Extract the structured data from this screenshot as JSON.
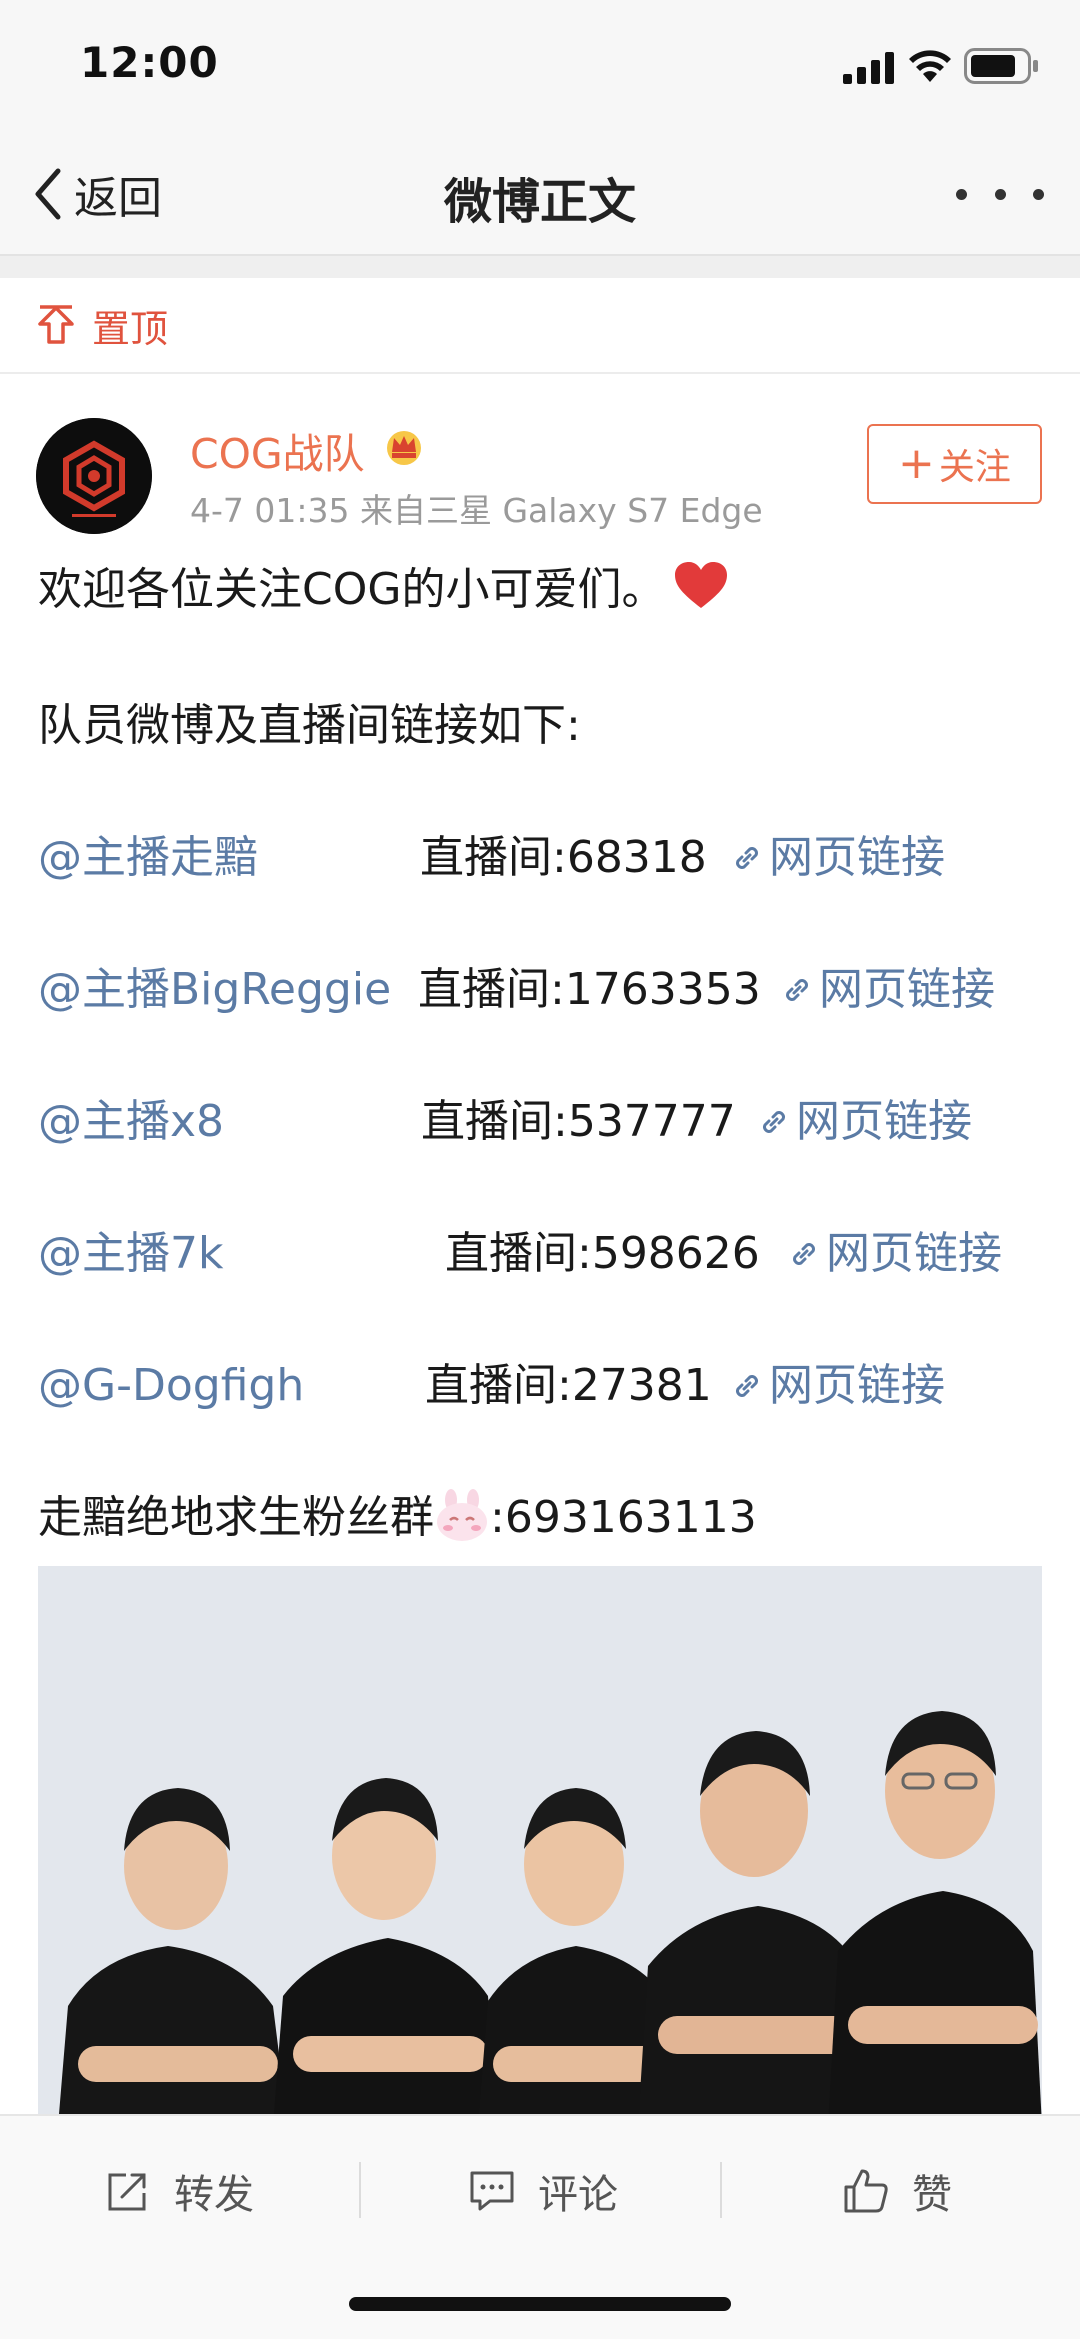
{
  "status_bar": {
    "time": "12:00"
  },
  "nav": {
    "back_label": "返回",
    "title": "微博正文"
  },
  "pinned": {
    "label": "置顶"
  },
  "post": {
    "user_name": "COG战队",
    "meta": "4-7 01:35  来自三星 Galaxy S7 Edge",
    "follow_label": "关注",
    "intro": "欢迎各位关注COG的小可爱们。",
    "links_heading": "队员微博及直播间链接如下:",
    "members": [
      {
        "mention": "@主播走黯",
        "stream": "直播间:68318",
        "link": "网页链接"
      },
      {
        "mention": "@主播BigReggie",
        "stream": "直播间:1763353",
        "link": "网页链接"
      },
      {
        "mention": "@主播x8",
        "stream": "直播间:537777",
        "link": "网页链接"
      },
      {
        "mention": "@主播7k",
        "stream": "直播间:598626",
        "link": "网页链接"
      },
      {
        "mention": "@G-Dogfigh",
        "stream": "直播间:27381",
        "link": "网页链接"
      }
    ],
    "fan_group_prefix": "走黯绝地求生粉丝群",
    "fan_group_number": ":693163113"
  },
  "toolbar": {
    "repost_label": "转发",
    "comment_label": "评论",
    "like_label": "赞"
  },
  "colors": {
    "accent_orange": "#eb7350",
    "pin_red": "#e0533e",
    "link_blue": "#5b7ba5",
    "meta_gray": "#9a9a9a"
  },
  "icons": [
    "chevron-left-icon",
    "more-icon",
    "pin-top-icon",
    "vip-crown-icon",
    "plus-icon",
    "link-icon",
    "heart-icon",
    "bunny-emoji-icon",
    "repost-icon",
    "comment-icon",
    "like-icon"
  ]
}
